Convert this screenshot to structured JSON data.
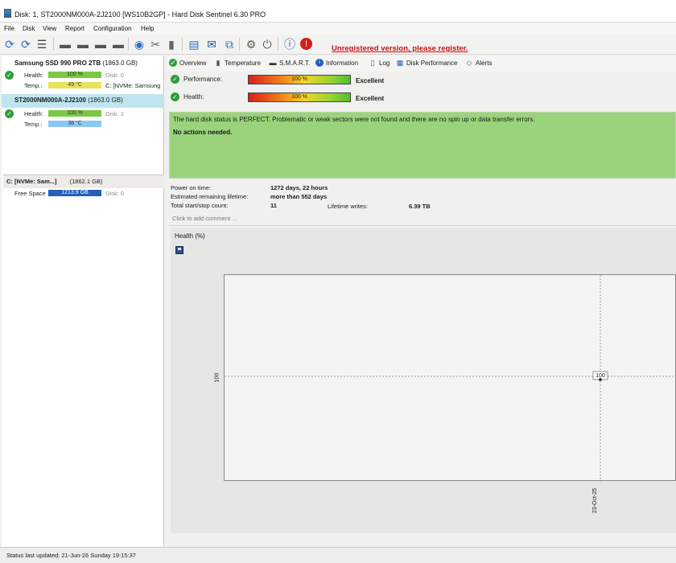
{
  "window": {
    "title": "Disk: 1, ST2000NM000A-2J2100 [WS10B2GP]  -  Hard Disk Sentinel 6.30 PRO"
  },
  "menu": [
    "File",
    "Disk",
    "View",
    "Report",
    "Configuration",
    "Help"
  ],
  "toolbar": {
    "icons": [
      "refresh-icon",
      "refresh-all-icon",
      "disk-list-icon",
      "hdd-icon",
      "hdd-info-icon",
      "hdd-remove-icon",
      "globe-icon",
      "tools-icon",
      "usb-icon",
      "report-icon",
      "mail-icon",
      "network-icon",
      "settings-icon",
      "power-icon",
      "help-icon",
      "alert-icon"
    ],
    "unregistered": "Unregistered version, please register."
  },
  "disks": [
    {
      "name": "Samsung SSD 990 PRO 2TB",
      "size": "(1863.0 GB)",
      "health_label": "Health:",
      "health": "100 %",
      "health_pct": 100,
      "disk": "Disk: 0",
      "temp_label": "Temp.:",
      "temp": "49 °C",
      "mount": "C: [NVMe: Samsung",
      "temp_color": "#e7e35a"
    },
    {
      "name": "ST2000NM000A-2J2100",
      "size": "(1863.0 GB)",
      "health_label": "Health:",
      "health": "100 %",
      "health_pct": 100,
      "disk": "Disk: 1",
      "temp_label": "Temp.:",
      "temp": "38 °C",
      "temp_color": "#8cc9f0"
    }
  ],
  "volume": {
    "name": "C: [NVMe: Sam...]",
    "size": "(1862.1 GB)",
    "free_label": "Free Space",
    "free": "1213.9 GB",
    "disk": "Disk: 0"
  },
  "tabs": [
    "Overview",
    "Temperature",
    "S.M.A.R.T.",
    "Information",
    "Log",
    "Disk Performance",
    "Alerts"
  ],
  "overview": {
    "performance_label": "Performance:",
    "performance_value": "100 %",
    "performance_pct": 100,
    "performance_rating": "Excellent",
    "health_label": "Health:",
    "health_value": "100 %",
    "health_pct": 100,
    "health_rating": "Excellent",
    "status_text": "The hard disk status is PERFECT. Problematic or weak sectors were not found and there are no spin up or data transfer errors.",
    "actions_text": "No actions needed.",
    "power_on_label": "Power on time:",
    "power_on_value": "1272 days, 22 hours",
    "lifetime_label": "Estimated remaining lifetime:",
    "lifetime_value": "more than 552 days",
    "startstop_label": "Total start/stop count:",
    "startstop_value": "11",
    "writes_label": "Lifetime writes:",
    "writes_value": "6.39 TB",
    "comment_placeholder": "Click to add comment ..."
  },
  "chart_data": {
    "type": "line",
    "title": "Health (%)",
    "x": [
      "23-Oct-25"
    ],
    "series": [
      {
        "values": [
          100
        ]
      }
    ],
    "ytick": "100",
    "point_label": "100"
  },
  "status": {
    "text": "Status last updated: 21-Jun-26 Sunday 19:15:37"
  }
}
